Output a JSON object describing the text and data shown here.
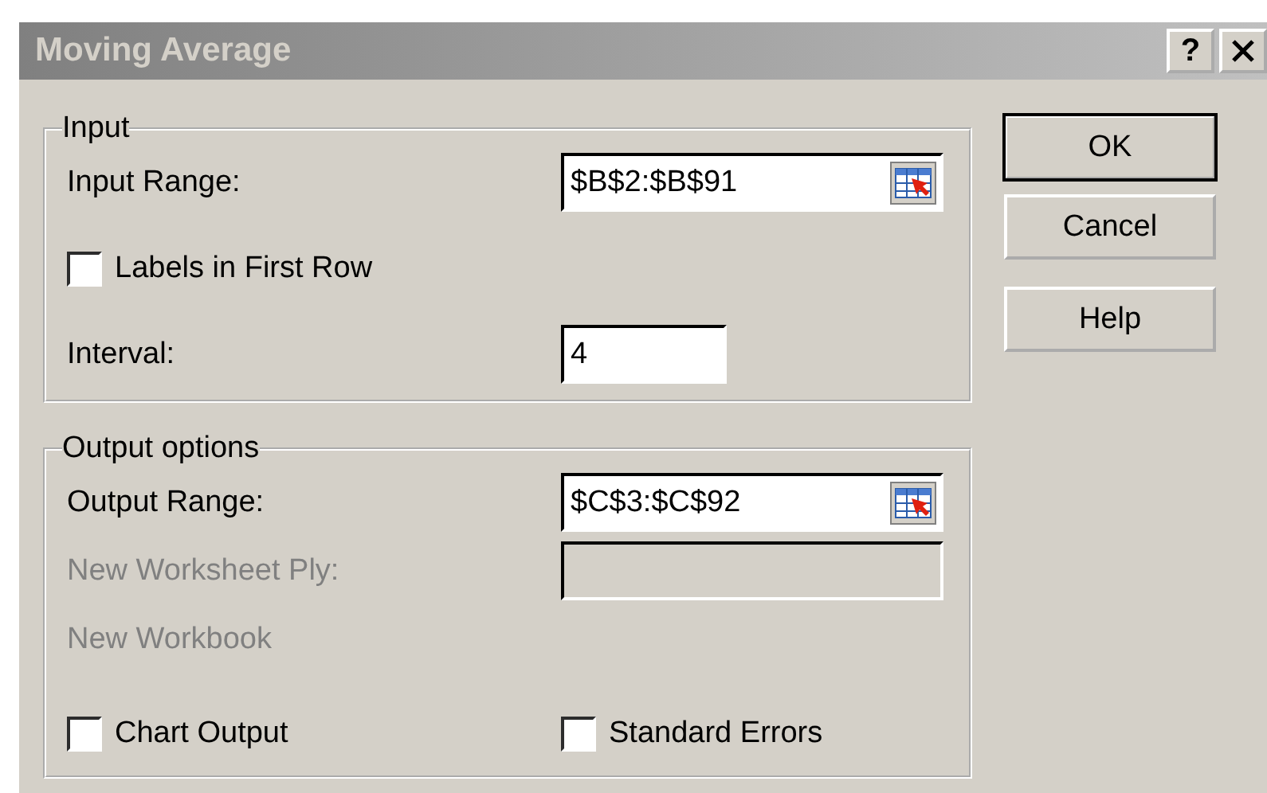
{
  "window": {
    "title": "Moving Average",
    "help_button": "?"
  },
  "input_group": {
    "legend": "Input",
    "rows": [
      {
        "kind": "range",
        "label": "Input Range:",
        "value": "$B$2:$B$91",
        "disabled": false
      },
      {
        "kind": "checkbox",
        "label": "Labels in First Row",
        "checked": false,
        "disabled": false
      },
      {
        "kind": "text",
        "label": "Interval:",
        "value": "4",
        "disabled": false
      }
    ]
  },
  "output_group": {
    "legend": "Output options",
    "rows": [
      {
        "kind": "range",
        "label": "Output Range:",
        "value": "$C$3:$C$92",
        "disabled": false
      },
      {
        "kind": "text",
        "label": "New Worksheet Ply:",
        "disabled": true
      },
      {
        "kind": "label",
        "label": "New Workbook",
        "disabled": true
      }
    ],
    "checkboxes": [
      {
        "label": "Chart Output",
        "checked": false
      },
      {
        "label": "Standard Errors",
        "checked": false
      }
    ]
  },
  "buttons": [
    {
      "label": "OK",
      "default": true
    },
    {
      "label": "Cancel",
      "default": false
    },
    {
      "label": "Help",
      "default": false
    }
  ]
}
